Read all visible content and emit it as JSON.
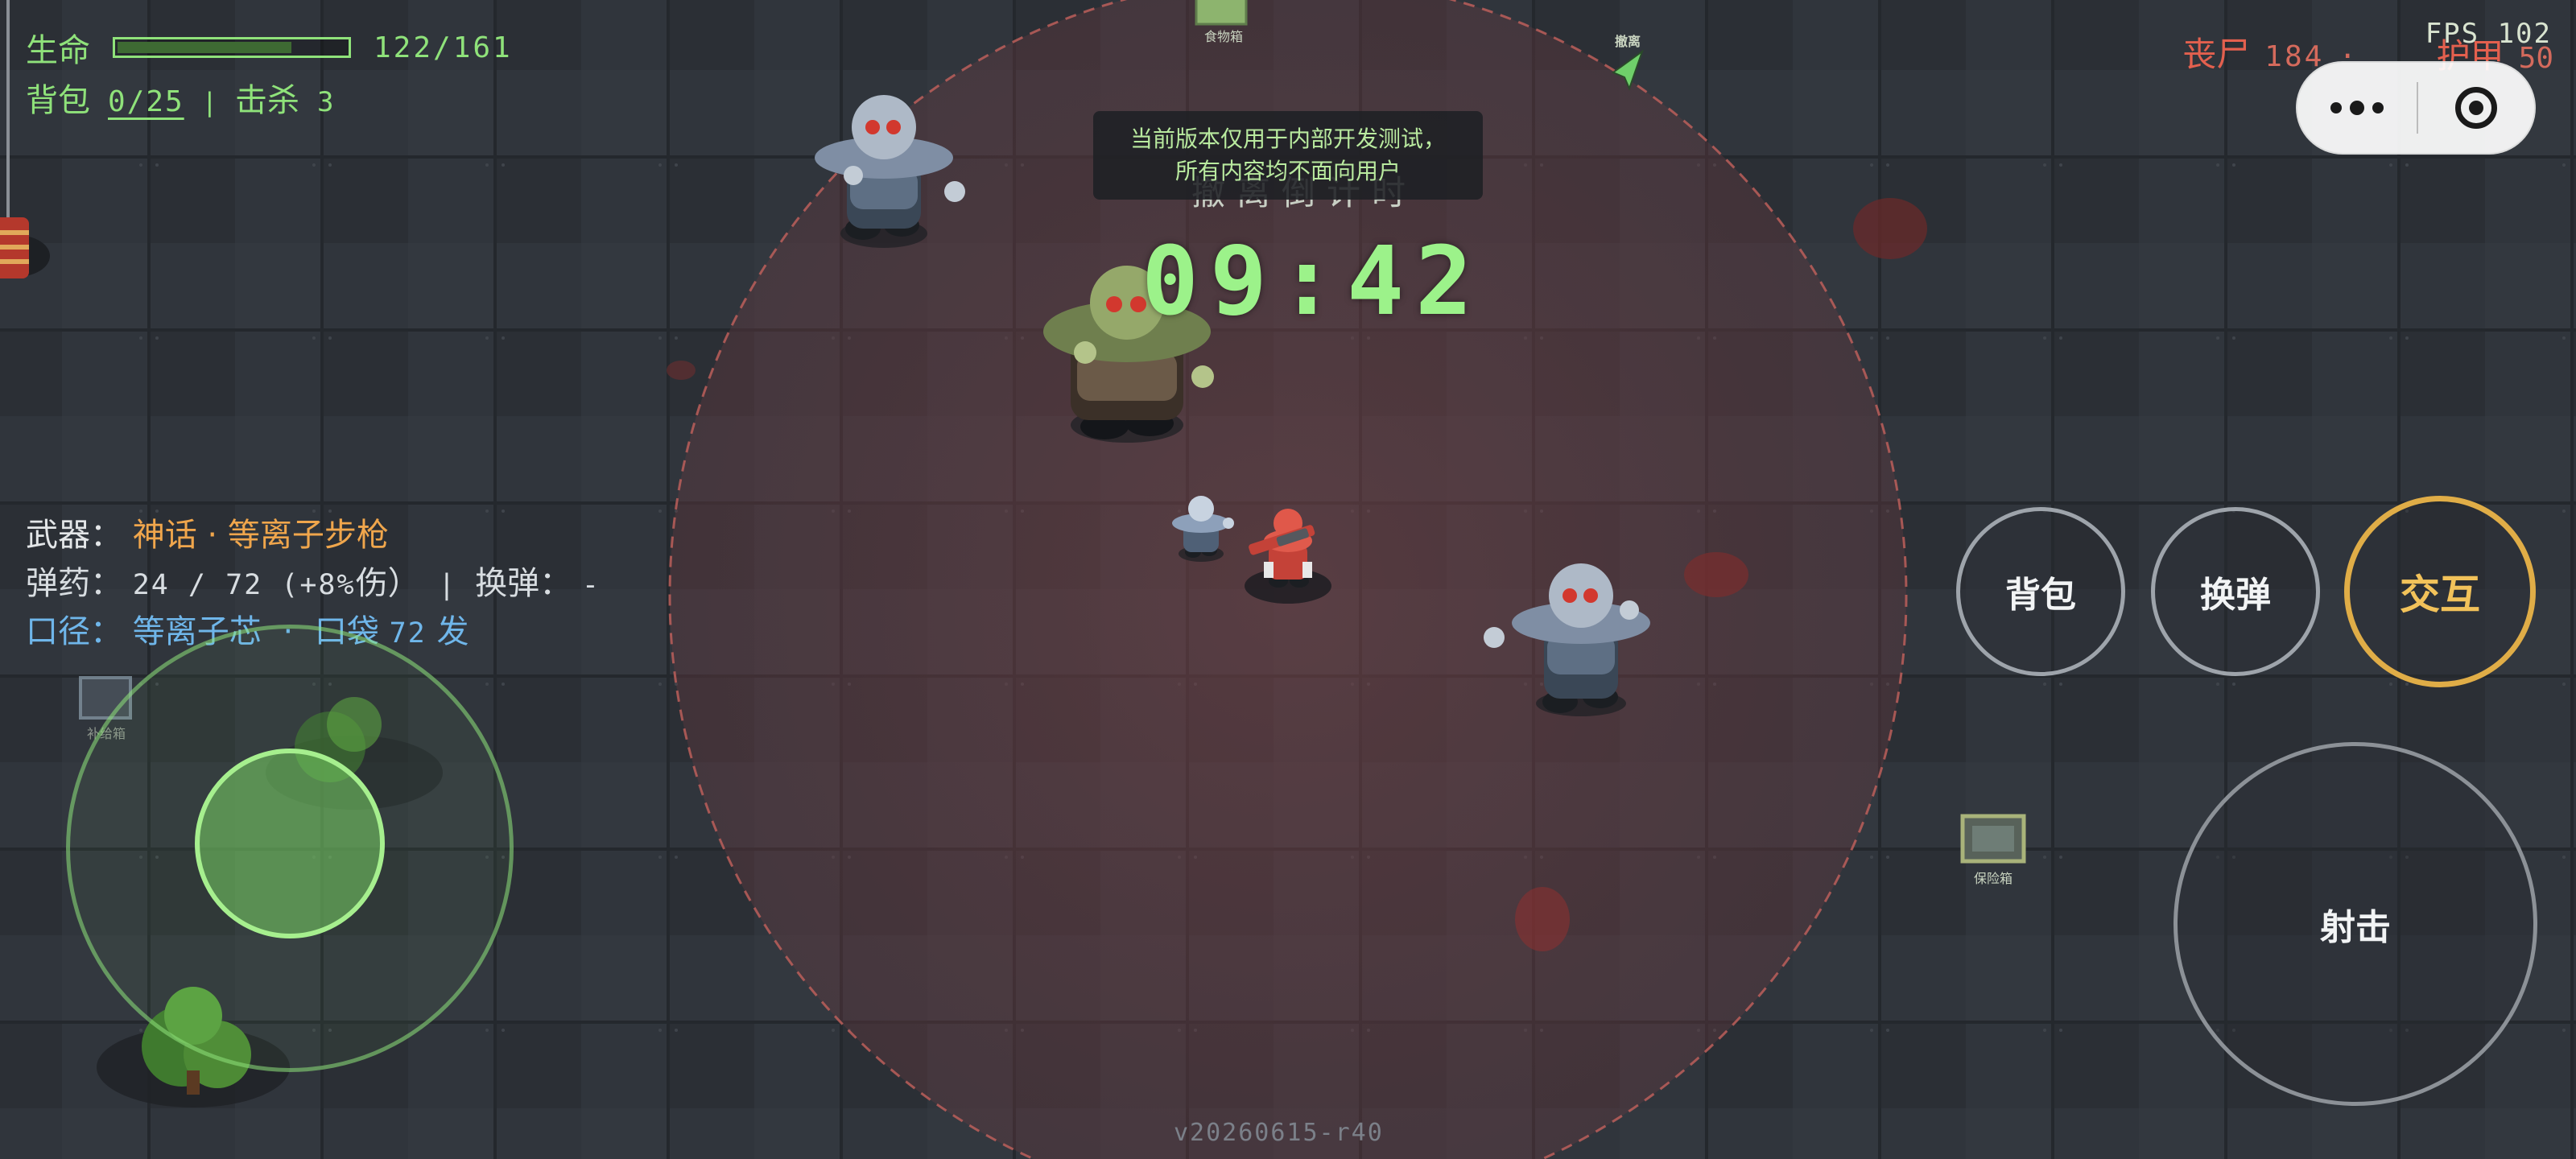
{
  "status": {
    "hp_label": "生命",
    "hp_value": "122/161",
    "hp_fraction": 0.76,
    "bag_label": "背包",
    "bag_value": "0/25",
    "separator": "|",
    "kills_label": "击杀",
    "kills_value": "3"
  },
  "top_right": {
    "zombies_label": "丧尸",
    "zombies_value": "184",
    "dot": "·",
    "armor_label": "护甲",
    "armor_value": "50",
    "fps": "FPS 102"
  },
  "notice": {
    "line1": "当前版本仅用于内部开发测试，",
    "line2": "所有内容均不面向用户"
  },
  "countdown": {
    "label": "撤离倒计时",
    "time": "09:42"
  },
  "weapon": {
    "weapon_label": "武器：",
    "weapon_value": "神话 · 等离子步枪",
    "ammo_label": "弹药：",
    "ammo_value": "24 / 72 (+8%",
    "ammo_dmg": "伤）",
    "reload_sep": "|",
    "reload_label": "换弹：",
    "reload_value": "-",
    "caliber_label": "口径：",
    "caliber_value": "等离子芯",
    "pocket_label": "口袋",
    "pocket_value": "72",
    "pocket_unit": "发"
  },
  "buttons": {
    "bag": "背包",
    "reload": "换弹",
    "interact": "交互",
    "fire": "射击"
  },
  "map_labels": {
    "food_box": "食物箱",
    "evac": "撤离",
    "safe_box": "保险箱",
    "left_box": "补给箱"
  },
  "version": "v20260615-r40",
  "colors": {
    "hud_green": "#8fe27a",
    "zombie_red": "#e3604e",
    "interact_gold": "#e0ad47",
    "weapon_orange": "#f0a64c",
    "caliber_blue": "#6fb6ea"
  }
}
